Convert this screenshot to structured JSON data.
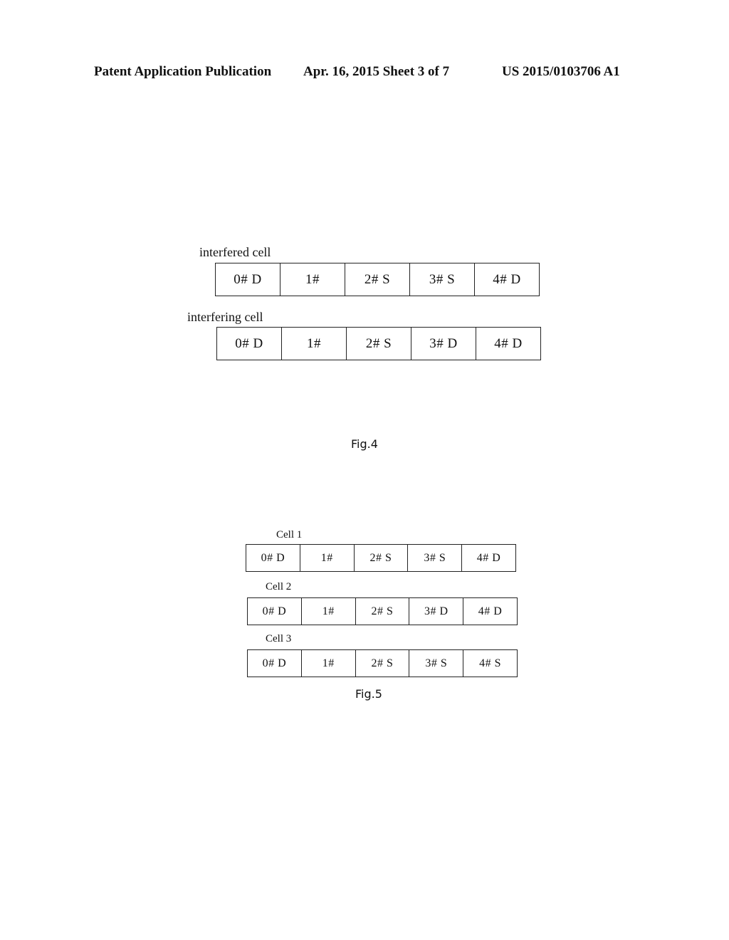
{
  "header": {
    "publication": "Patent Application Publication",
    "date_sheet": "Apr. 16, 2015  Sheet 3 of 7",
    "number": "US 2015/0103706 A1"
  },
  "fig4": {
    "caption": "Fig.4",
    "rows": [
      {
        "label": "interfered cell",
        "slots": [
          "0# D",
          "1#",
          "2# S",
          "3# S",
          "4# D"
        ]
      },
      {
        "label": "interfering cell",
        "slots": [
          "0# D",
          "1#",
          "2# S",
          "3# D",
          "4# D"
        ]
      }
    ]
  },
  "fig5": {
    "caption": "Fig.5",
    "rows": [
      {
        "label": "Cell 1",
        "slots": [
          "0# D",
          "1#",
          "2# S",
          "3# S",
          "4# D"
        ]
      },
      {
        "label": "Cell 2",
        "slots": [
          "0# D",
          "1#",
          "2# S",
          "3# D",
          "4# D"
        ]
      },
      {
        "label": "Cell 3",
        "slots": [
          "0# D",
          "1#",
          "2# S",
          "3# S",
          "4# S"
        ]
      }
    ]
  }
}
